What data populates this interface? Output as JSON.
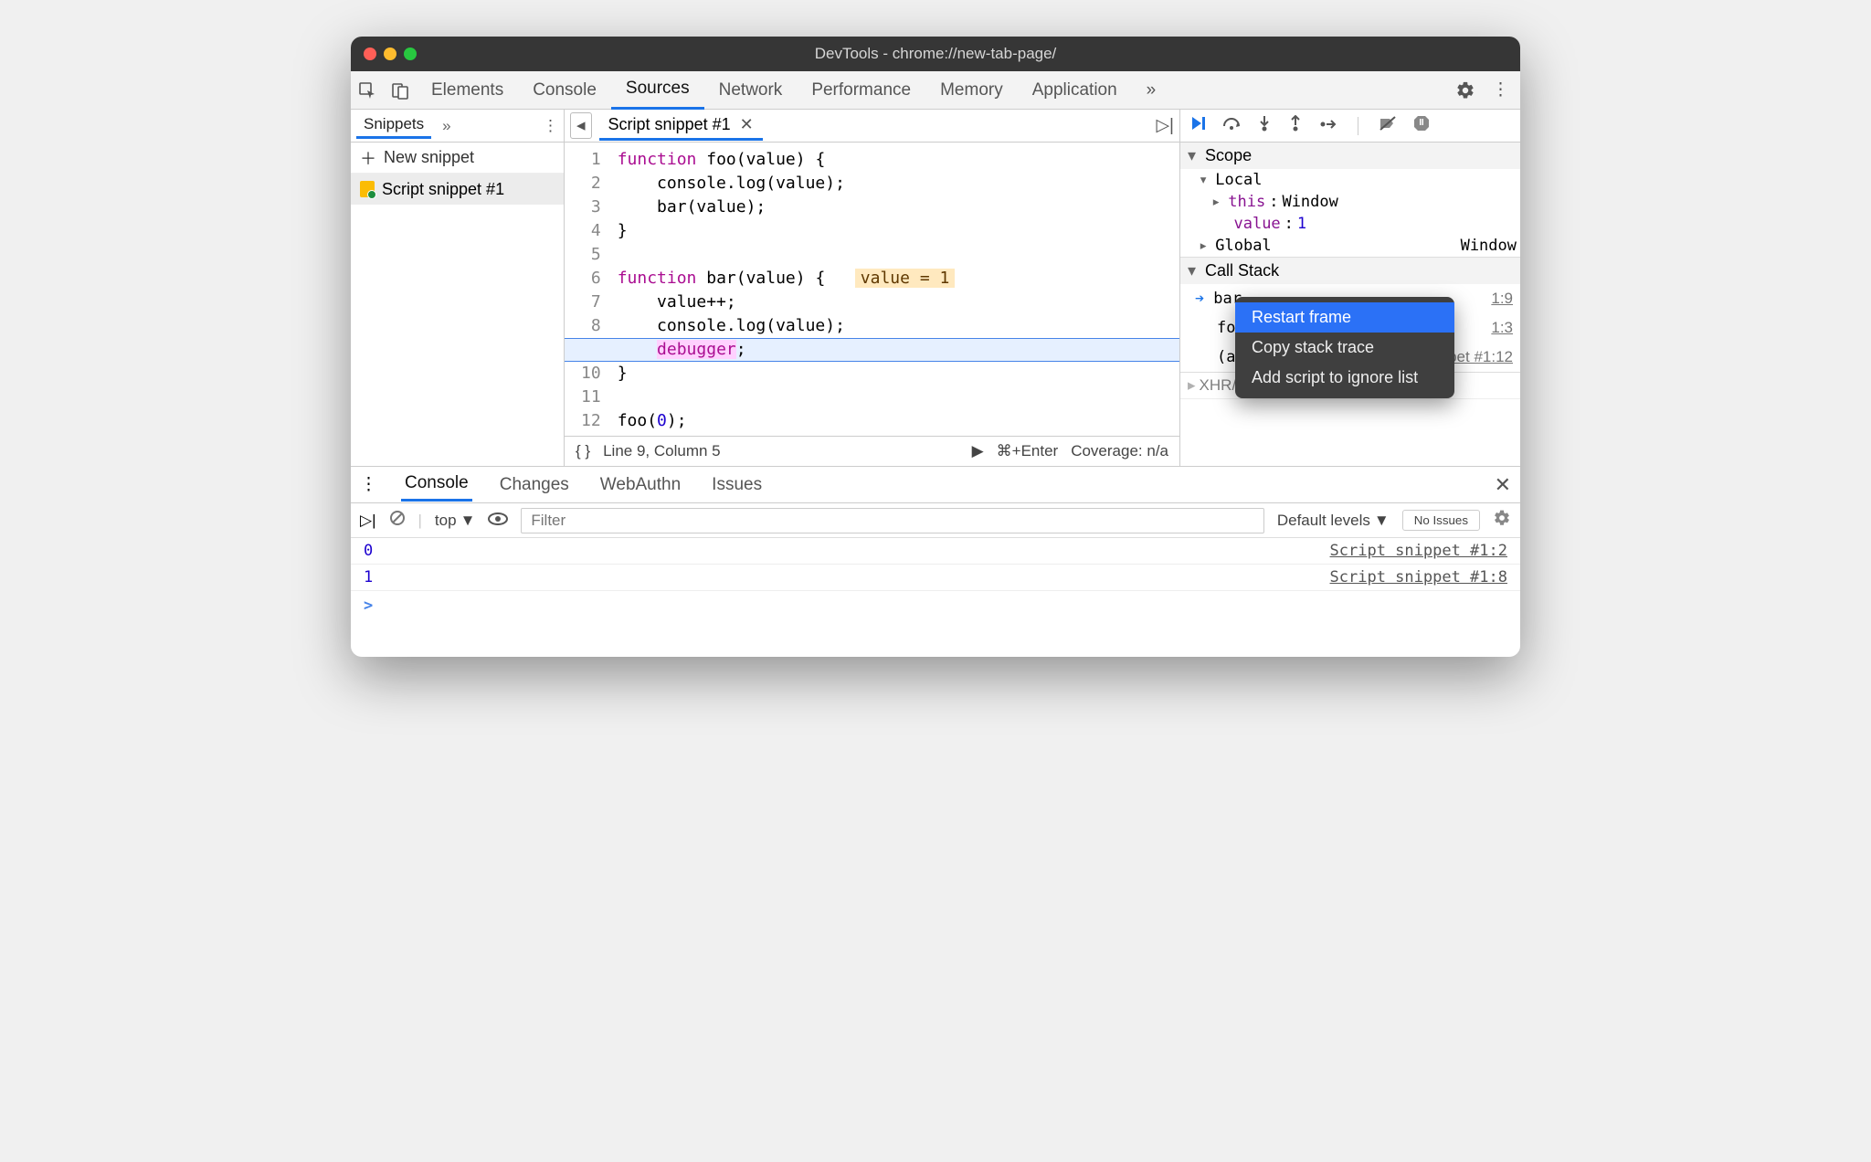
{
  "window": {
    "title": "DevTools - chrome://new-tab-page/"
  },
  "main_tabs": [
    "Elements",
    "Console",
    "Sources",
    "Network",
    "Performance",
    "Memory",
    "Application"
  ],
  "main_tab_active": "Sources",
  "sidebar": {
    "tab": "Snippets",
    "new_snippet": "New snippet",
    "items": [
      {
        "label": "Script snippet #1"
      }
    ]
  },
  "editor": {
    "tab": "Script snippet #1",
    "lines": [
      "function foo(value) {",
      "    console.log(value);",
      "    bar(value);",
      "}",
      "",
      "function bar(value) {",
      "    value++;",
      "    console.log(value);",
      "    debugger;",
      "}",
      "",
      "foo(0);",
      ""
    ],
    "value_hint": "value = 1",
    "status_left": "Line 9, Column 5",
    "run_hint": "⌘+Enter",
    "coverage": "Coverage: n/a"
  },
  "debug": {
    "scope_label": "Scope",
    "scope": {
      "local_label": "Local",
      "this_label": "this",
      "this_value": "Window",
      "value_label": "value",
      "value_value": "1",
      "global_label": "Global",
      "global_value": "Window"
    },
    "callstack_label": "Call Stack",
    "callstack": [
      {
        "fn": "bar",
        "loc": "1:9",
        "current": true
      },
      {
        "fn": "foo",
        "loc": "1:3",
        "current": false
      },
      {
        "fn": "(anonymous)",
        "loc": "Script snippet #1:12",
        "current": false
      }
    ],
    "xhr_label": "XHR/fetch Breakpoints"
  },
  "context_menu": {
    "items": [
      "Restart frame",
      "Copy stack trace",
      "Add script to ignore list"
    ],
    "highlighted": 0
  },
  "drawer": {
    "tabs": [
      "Console",
      "Changes",
      "WebAuthn",
      "Issues"
    ],
    "active": "Console"
  },
  "console": {
    "context": "top",
    "filter_placeholder": "Filter",
    "levels": "Default levels",
    "no_issues": "No Issues",
    "rows": [
      {
        "value": "0",
        "source": "Script snippet #1:2"
      },
      {
        "value": "1",
        "source": "Script snippet #1:8"
      }
    ],
    "prompt": ">"
  }
}
